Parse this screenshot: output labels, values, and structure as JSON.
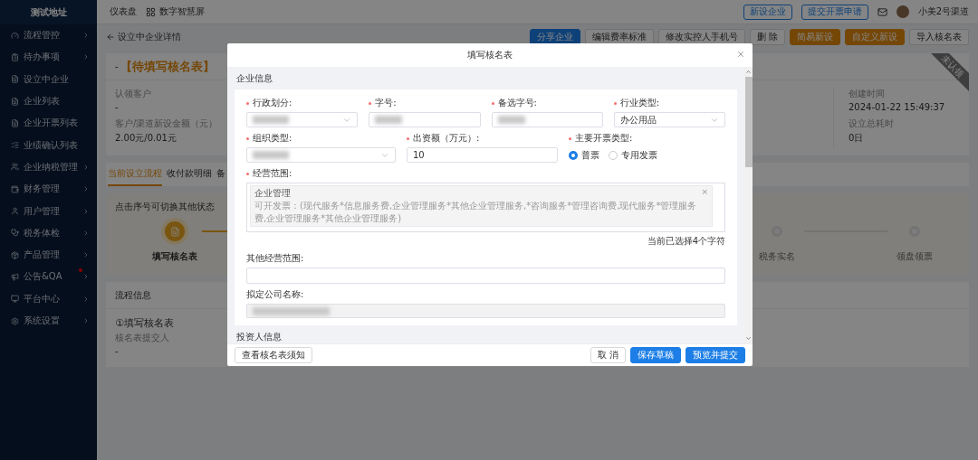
{
  "sidebar": {
    "title": "测试地址",
    "items": [
      {
        "label": "流程管控",
        "has_children": true,
        "badge": false
      },
      {
        "label": "待办事项",
        "has_children": true,
        "badge": false
      },
      {
        "label": "设立中企业",
        "has_children": false,
        "badge": false
      },
      {
        "label": "企业列表",
        "has_children": false,
        "badge": false
      },
      {
        "label": "企业开票列表",
        "has_children": false,
        "badge": false
      },
      {
        "label": "业绩确认列表",
        "has_children": false,
        "badge": false
      },
      {
        "label": "企业纳税管理",
        "has_children": true,
        "badge": false
      },
      {
        "label": "财务管理",
        "has_children": true,
        "badge": false
      },
      {
        "label": "用户管理",
        "has_children": true,
        "badge": false
      },
      {
        "label": "税务体检",
        "has_children": true,
        "badge": false
      },
      {
        "label": "产品管理",
        "has_children": true,
        "badge": false
      },
      {
        "label": "公告&QA",
        "has_children": true,
        "badge": true
      },
      {
        "label": "平台中心",
        "has_children": true,
        "badge": false
      },
      {
        "label": "系统设置",
        "has_children": true,
        "badge": false
      }
    ]
  },
  "topbar": {
    "links": [
      "仪表盘",
      "数字智慧屏"
    ],
    "buttons": [
      "新设企业",
      "提交开票申请"
    ],
    "user": "小美2号渠道"
  },
  "subheader": {
    "back": "设立中企业详情",
    "buttons": [
      {
        "label": "分享企业",
        "kind": "primary"
      },
      {
        "label": "编辑费率标准",
        "kind": "default"
      },
      {
        "label": "修改实控人手机号",
        "kind": "default"
      },
      {
        "label": "删 除",
        "kind": "default"
      },
      {
        "label": "简易新设",
        "kind": "warning"
      },
      {
        "label": "自定义新设",
        "kind": "warning"
      },
      {
        "label": "导入核名表",
        "kind": "default"
      }
    ]
  },
  "summary": {
    "title_prefix": "-",
    "status": "【待填写核名表】",
    "ribbon": "未认领",
    "left_fields": [
      {
        "label": "认领客户",
        "value": "-"
      },
      {
        "label": "客户/渠道新设金额（元）",
        "value": "2.00元/0.01元"
      }
    ],
    "right_fields": [
      {
        "label": "创建时间",
        "value": "2024-01-22 15:49:37"
      },
      {
        "label": "设立总耗时",
        "value": "0日"
      }
    ]
  },
  "tabs": [
    {
      "label": "当前设立流程",
      "selected": true
    },
    {
      "label": "收付款明细",
      "selected": false
    },
    {
      "label": "备",
      "selected": false
    }
  ],
  "steps": {
    "hint": "点击序号可切换其他状态",
    "items": [
      {
        "label": "填写核名表",
        "active": true
      },
      {
        "label": "税务实名",
        "active": false
      },
      {
        "label": "领盘领票",
        "active": false
      }
    ]
  },
  "flow_info": {
    "title": "流程信息",
    "step": "①填写核名表",
    "sub": "核名表提交人",
    "value": "-"
  },
  "modal": {
    "title": "填写核名表",
    "sections": [
      {
        "title": "企业信息"
      },
      {
        "title": "投资人信息"
      }
    ],
    "row1": [
      {
        "label": "行政划分:",
        "kind": "select",
        "required": true,
        "redacted": true
      },
      {
        "label": "字号:",
        "kind": "input",
        "required": true,
        "redacted": true
      },
      {
        "label": "备选字号:",
        "kind": "input",
        "required": true,
        "redacted": true
      },
      {
        "label": "行业类型:",
        "kind": "select",
        "required": true,
        "value": "办公用品"
      }
    ],
    "row2": [
      {
        "label": "组织类型:",
        "kind": "select",
        "required": true,
        "redacted": true
      },
      {
        "label": "出资额（万元）:",
        "kind": "input",
        "required": true,
        "value": "10"
      },
      {
        "label": "主要开票类型:",
        "kind": "radio",
        "required": true,
        "options": [
          {
            "label": "普票",
            "selected": true
          },
          {
            "label": "专用发票",
            "selected": false
          }
        ]
      }
    ],
    "scope": {
      "label": "经营范围:",
      "required": true,
      "tag": "企业管理",
      "detail": "可开发票：(现代服务*信息服务费,企业管理服务*其他企业管理服务,*咨询服务*管理咨询费,现代服务*管理服务费,企业管理服务*其他企业管理服务)",
      "remove": "×",
      "count": "当前已选择4个字符"
    },
    "other_scope": {
      "label": "其他经营范围:",
      "required": false
    },
    "company_name": {
      "label": "拟定公司名称:",
      "required": false,
      "disabled": true,
      "redacted": true
    },
    "footer": {
      "left": "查看核名表须知",
      "buttons": [
        {
          "label": "取 消",
          "kind": "default"
        },
        {
          "label": "保存草稿",
          "kind": "primary"
        },
        {
          "label": "预览并提交",
          "kind": "primary"
        }
      ]
    }
  }
}
